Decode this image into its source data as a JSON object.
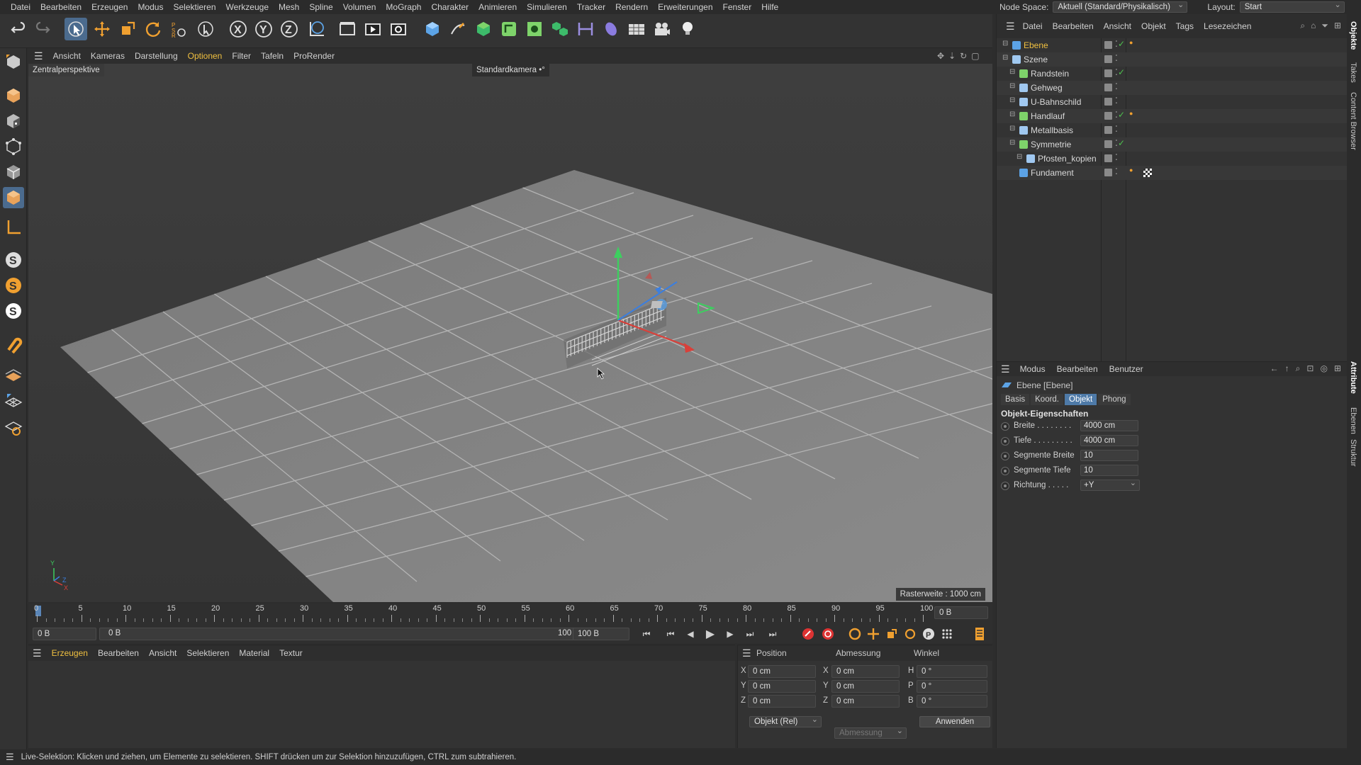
{
  "menu": [
    "Datei",
    "Bearbeiten",
    "Erzeugen",
    "Modus",
    "Selektieren",
    "Werkzeuge",
    "Mesh",
    "Spline",
    "Volumen",
    "MoGraph",
    "Charakter",
    "Animieren",
    "Simulieren",
    "Tracker",
    "Rendern",
    "Erweiterungen",
    "Fenster",
    "Hilfe"
  ],
  "node_space": {
    "label": "Node Space:",
    "value": "Aktuell (Standard/Physikalisch)",
    "layout_label": "Layout:",
    "layout_value": "Start"
  },
  "viewport": {
    "menu": [
      "Ansicht",
      "Kameras",
      "Darstellung",
      "Optionen",
      "Filter",
      "Tafeln",
      "ProRender"
    ],
    "active_menu": "Optionen",
    "perspective_label": "Zentralperspektive",
    "camera_label": "Standardkamera",
    "grid_label": "Rasterweite : 1000 cm",
    "axis_y": "Y",
    "axis_x": "X",
    "axis_z": "Z"
  },
  "timeline": {
    "ticks": [
      "0",
      "5",
      "10",
      "15",
      "20",
      "25",
      "30",
      "35",
      "40",
      "45",
      "50",
      "55",
      "60",
      "65",
      "70",
      "75",
      "80",
      "85",
      "90",
      "95",
      "100"
    ],
    "current_frame": "0 B",
    "start_field": "0 B",
    "range_start": "0 B",
    "range_end": "100 B",
    "end_field": "100 B"
  },
  "material_manager": {
    "menu": [
      "Erzeugen",
      "Bearbeiten",
      "Ansicht",
      "Selektieren",
      "Material",
      "Textur"
    ],
    "active": "Erzeugen"
  },
  "coordinates": {
    "headers": [
      "Position",
      "Abmessung",
      "Winkel"
    ],
    "rows": [
      {
        "axis": "X",
        "pos": "0 cm",
        "saxis": "X",
        "size": "0 cm",
        "raxis": "H",
        "rot": "0 °"
      },
      {
        "axis": "Y",
        "pos": "0 cm",
        "saxis": "Y",
        "size": "0 cm",
        "raxis": "P",
        "rot": "0 °"
      },
      {
        "axis": "Z",
        "pos": "0 cm",
        "saxis": "Z",
        "size": "0 cm",
        "raxis": "B",
        "rot": "0 °"
      }
    ],
    "mode": "Objekt (Rel)",
    "size_mode": "Abmessung",
    "apply": "Anwenden"
  },
  "object_manager": {
    "menu": [
      "Datei",
      "Bearbeiten",
      "Ansicht",
      "Objekt",
      "Tags",
      "Lesezeichen"
    ],
    "objects": [
      {
        "name": "Ebene",
        "indent": 0,
        "color": "#5ca3e6",
        "selected": true
      },
      {
        "name": "Szene",
        "indent": 0,
        "color": "#a0c8f0"
      },
      {
        "name": "Randstein",
        "indent": 1,
        "color": "#7ed36a"
      },
      {
        "name": "Gehweg",
        "indent": 1,
        "color": "#a0c8f0"
      },
      {
        "name": "U-Bahnschild",
        "indent": 1,
        "color": "#a0c8f0"
      },
      {
        "name": "Handlauf",
        "indent": 1,
        "color": "#7ed36a"
      },
      {
        "name": "Metallbasis",
        "indent": 1,
        "color": "#a0c8f0"
      },
      {
        "name": "Symmetrie",
        "indent": 1,
        "color": "#7ed36a"
      },
      {
        "name": "Pfosten_kopien",
        "indent": 2,
        "color": "#a0c8f0"
      },
      {
        "name": "Fundament",
        "indent": 1,
        "color": "#5ca3e6"
      }
    ]
  },
  "attributes": {
    "menu": [
      "Modus",
      "Bearbeiten",
      "Benutzer"
    ],
    "object_title": "Ebene [Ebene]",
    "tabs": [
      "Basis",
      "Koord.",
      "Objekt",
      "Phong"
    ],
    "active_tab": "Objekt",
    "section": "Objekt-Eigenschaften",
    "props": [
      {
        "label": "Breite . . . . . . . .",
        "value": "4000 cm"
      },
      {
        "label": "Tiefe . . . . . . . . .",
        "value": "4000 cm"
      },
      {
        "label": "Segmente Breite",
        "value": "10"
      },
      {
        "label": "Segmente Tiefe",
        "value": "10"
      },
      {
        "label": "Richtung . . . . .",
        "value": "+Y"
      }
    ]
  },
  "right_tabs": [
    "Objekte",
    "Takes",
    "Content Browser",
    "Attribute",
    "Ebenen",
    "Struktur"
  ],
  "status": "Live-Selektion: Klicken und ziehen, um Elemente zu selektieren. SHIFT drücken um zur Selektion hinzuzufügen, CTRL zum subtrahieren."
}
